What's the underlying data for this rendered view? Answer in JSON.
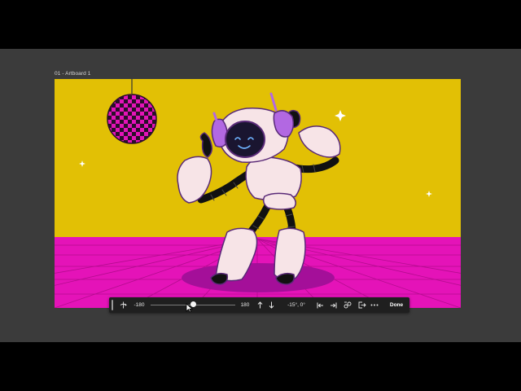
{
  "artboard": {
    "label": "01 - Artboard 1"
  },
  "colors": {
    "workspace": "#3b3b3b",
    "background_yellow": "#e2c005",
    "floor_magenta": "#e413b8",
    "robot_body": "#f7e4e7",
    "robot_outline": "#5a2a78",
    "headphone_purple": "#b268e2",
    "toolbar": "#1f1f1f"
  },
  "toolbar": {
    "min_value": "-180",
    "max_value": "180",
    "slider_fraction": 0.5,
    "rotation_readout": "-15°, 0°",
    "done_label": "Done",
    "icons": [
      "rotate-axis-icon",
      "arrow-up-icon",
      "arrow-down-icon",
      "align-left-icon",
      "align-right-icon",
      "transform-icon",
      "export-icon",
      "more-icon"
    ]
  }
}
